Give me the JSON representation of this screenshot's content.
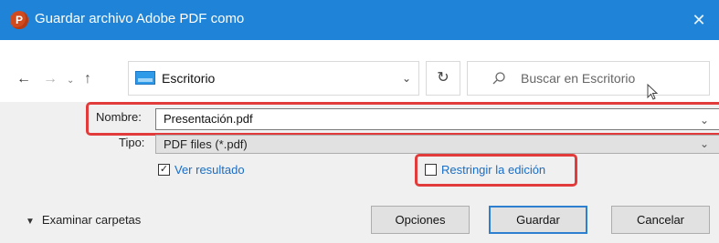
{
  "window": {
    "title": "Guardar archivo Adobe PDF como",
    "app_icon_letter": "P",
    "close_glyph": "✕"
  },
  "nav": {
    "back_glyph": "←",
    "forward_glyph": "→",
    "recent_glyph": "⌄",
    "up_glyph": "↑",
    "address": "Escritorio",
    "dropdown_glyph": "⌄",
    "refresh_glyph": "↻",
    "search_placeholder": "Buscar en Escritorio"
  },
  "form": {
    "name_label": "Nombre:",
    "name_value": "Presentación.pdf",
    "type_label": "Tipo:",
    "type_value": "PDF files (*.pdf)",
    "chevron": "⌄",
    "view_result_label": "Ver resultado",
    "view_result_checked": true,
    "restrict_edit_label": "Restringir la edición",
    "restrict_edit_checked": false
  },
  "footer": {
    "browse_folders_label": "Examinar carpetas",
    "options_label": "Opciones",
    "save_label": "Guardar",
    "cancel_label": "Cancelar"
  },
  "colors": {
    "titlebar": "#1f84d8",
    "highlight": "#e23b3b",
    "link": "#1a6dc4",
    "primary_border": "#2f7fd1"
  }
}
